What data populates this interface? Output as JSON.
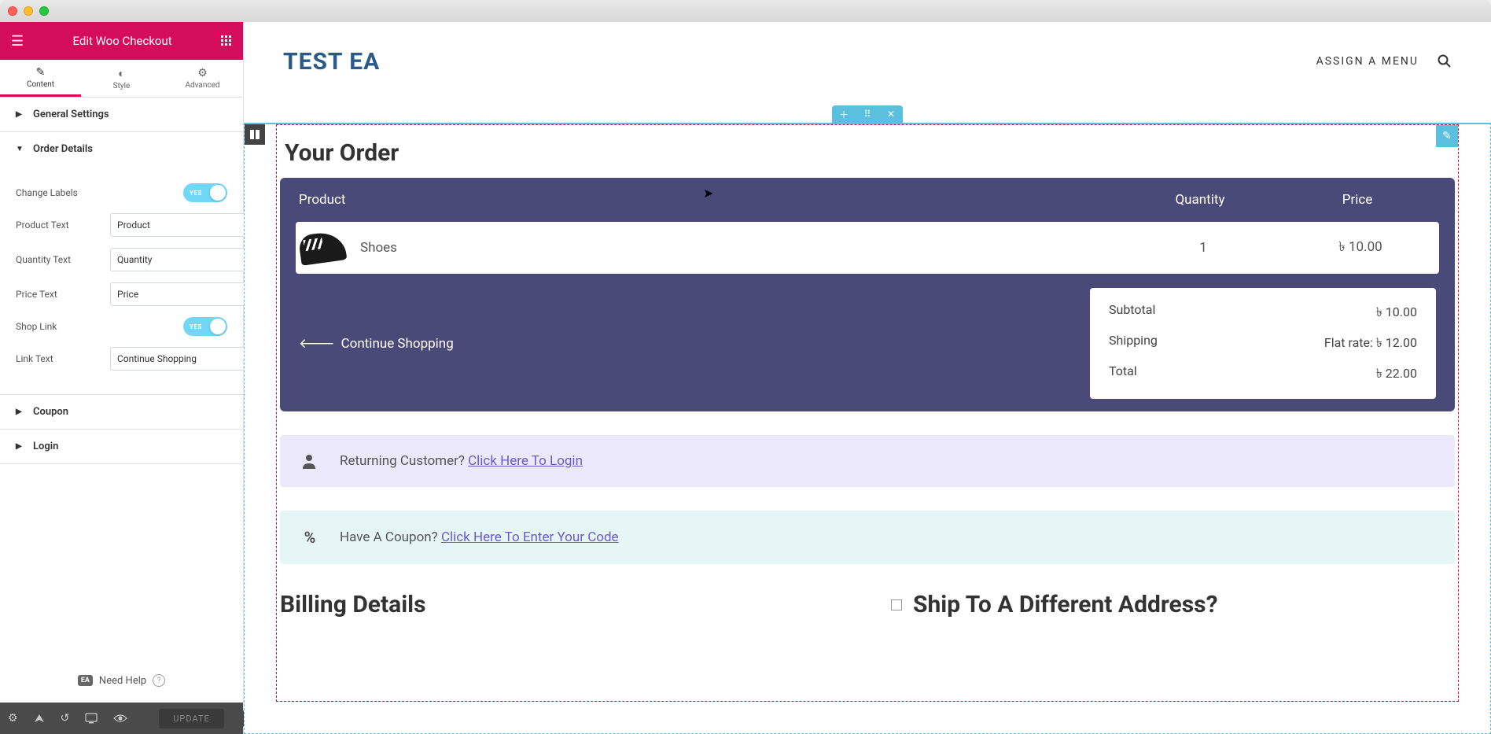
{
  "editor": {
    "title": "Edit Woo Checkout",
    "tabs": {
      "content": "Content",
      "style": "Style",
      "advanced": "Advanced"
    },
    "sections": {
      "general": "General Settings",
      "order_details": "Order Details",
      "coupon": "Coupon",
      "login": "Login"
    },
    "controls": {
      "change_labels": "Change Labels",
      "change_labels_state": "YES",
      "product_text_label": "Product Text",
      "product_text_value": "Product",
      "quantity_text_label": "Quantity Text",
      "quantity_text_value": "Quantity",
      "price_text_label": "Price Text",
      "price_text_value": "Price",
      "shop_link": "Shop Link",
      "shop_link_state": "YES",
      "link_text_label": "Link Text",
      "link_text_value": "Continue Shopping"
    },
    "need_help_badge": "EA",
    "need_help": "Need Help",
    "update": "UPDATE"
  },
  "site": {
    "title": "TEST EA",
    "menu_label": "ASSIGN A MENU"
  },
  "checkout": {
    "your_order": "Your Order",
    "headers": {
      "product": "Product",
      "qty": "Quantity",
      "price": "Price"
    },
    "item": {
      "name": "Shoes",
      "qty": "1",
      "price": "৳ 10.00"
    },
    "continue": "Continue Shopping",
    "totals": {
      "subtotal_label": "Subtotal",
      "subtotal_value": "৳ 10.00",
      "shipping_label": "Shipping",
      "shipping_value": "Flat rate: ৳ 12.00",
      "total_label": "Total",
      "total_value": "৳ 22.00"
    },
    "login_text": "Returning Customer? ",
    "login_link": "Click Here To Login",
    "coupon_text": "Have A Coupon? ",
    "coupon_link": "Click Here To Enter Your Code",
    "billing": "Billing Details",
    "ship_diff": "Ship To A Different Address?"
  }
}
